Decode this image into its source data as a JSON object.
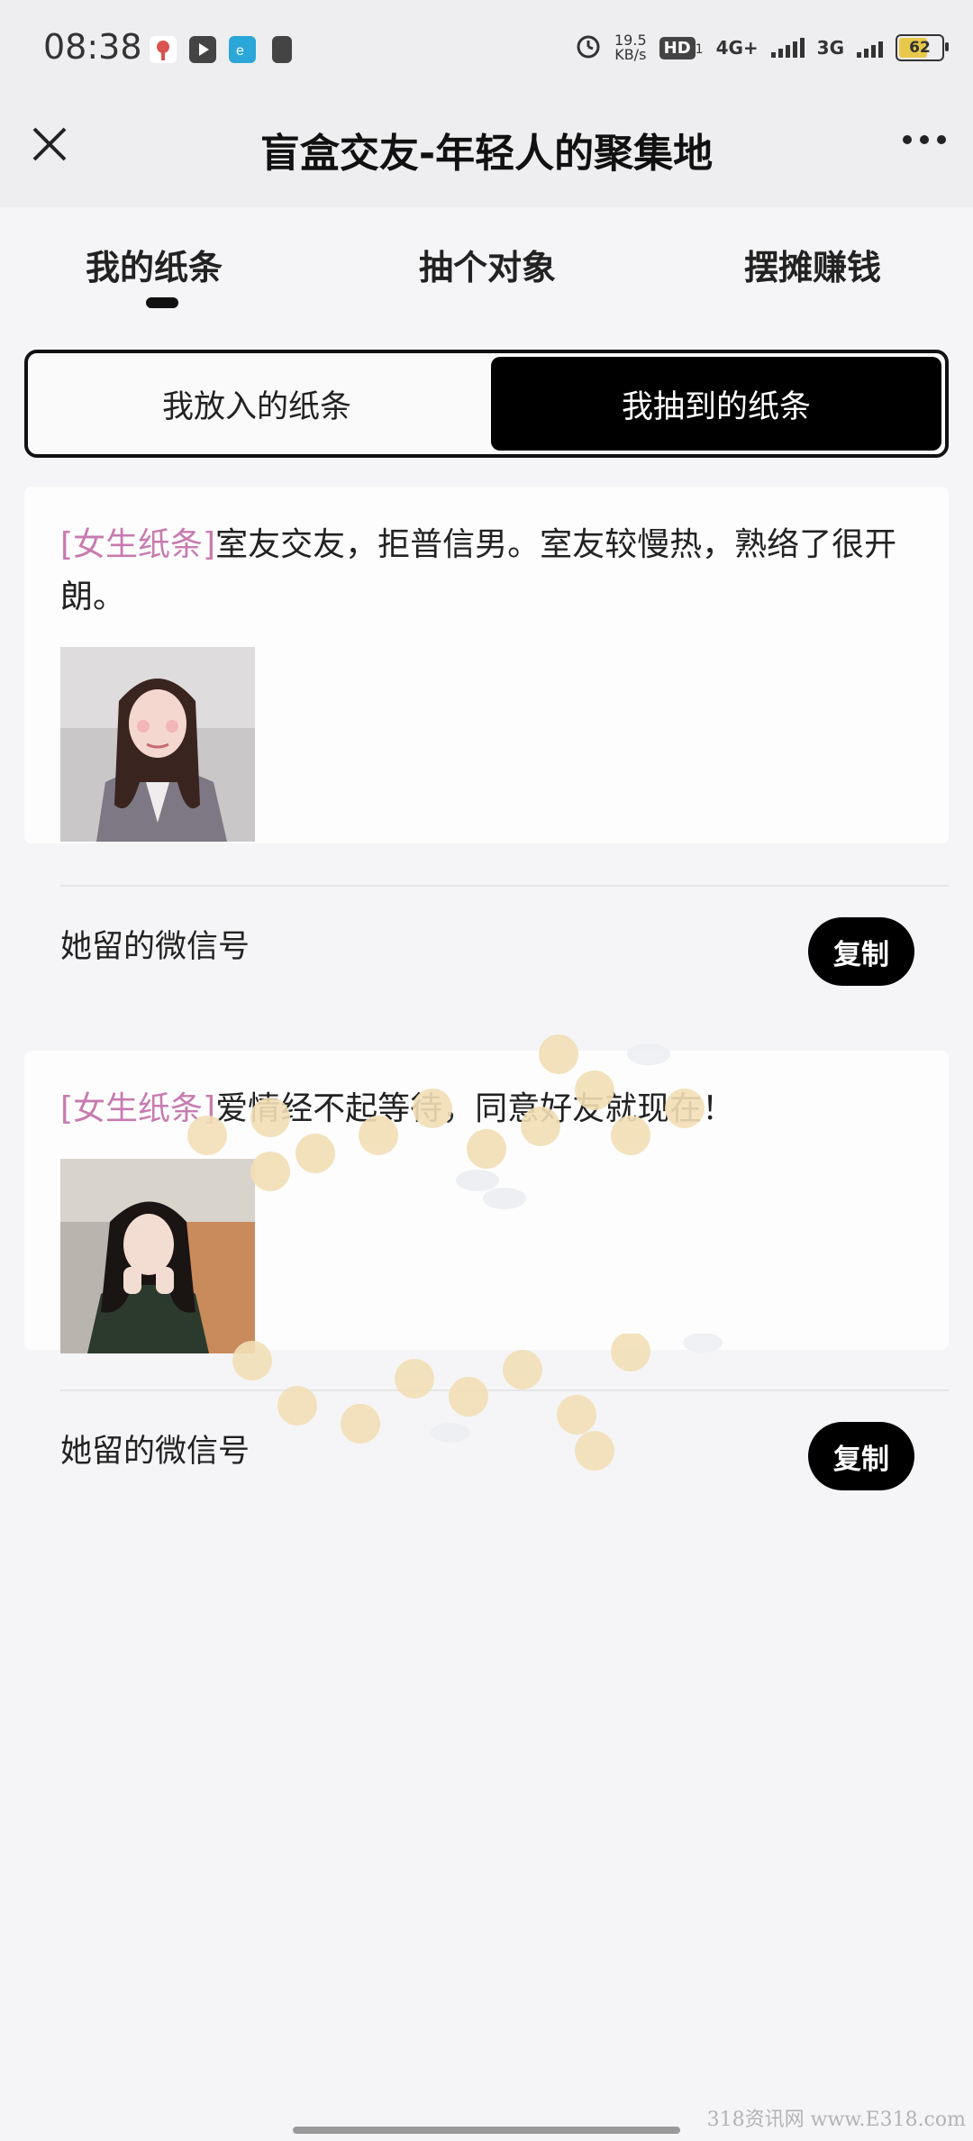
{
  "status_bar": {
    "time": "08:38",
    "net_speed_value": "19.5",
    "net_speed_unit": "KB/s",
    "hd_label": "HD",
    "hd_sub": "1",
    "net1": "4G+",
    "net2": "3G",
    "battery": "62"
  },
  "header": {
    "title": "盲盒交友-年轻人的聚集地"
  },
  "tabs": [
    {
      "label": "我的纸条"
    },
    {
      "label": "抽个对象"
    },
    {
      "label": "摆摊赚钱"
    }
  ],
  "segmented": {
    "left_label": "我放入的纸条",
    "right_label": "我抽到的纸条"
  },
  "cards": [
    {
      "tag": "[女生纸条]",
      "text": "室友交友，拒普信男。室友较慢热，熟络了很开朗。",
      "wechat_label": "她留的微信号",
      "copy_label": "复制"
    },
    {
      "tag": "[女生纸条]",
      "text": "爱情经不起等待，同意好友就现在！",
      "wechat_label": "她留的微信号",
      "copy_label": "复制"
    }
  ],
  "watermark": "318资讯网 www.E318.com",
  "colors": {
    "tag": "#c77bb0",
    "accent": "#000000",
    "background": "#f5f5f7"
  }
}
